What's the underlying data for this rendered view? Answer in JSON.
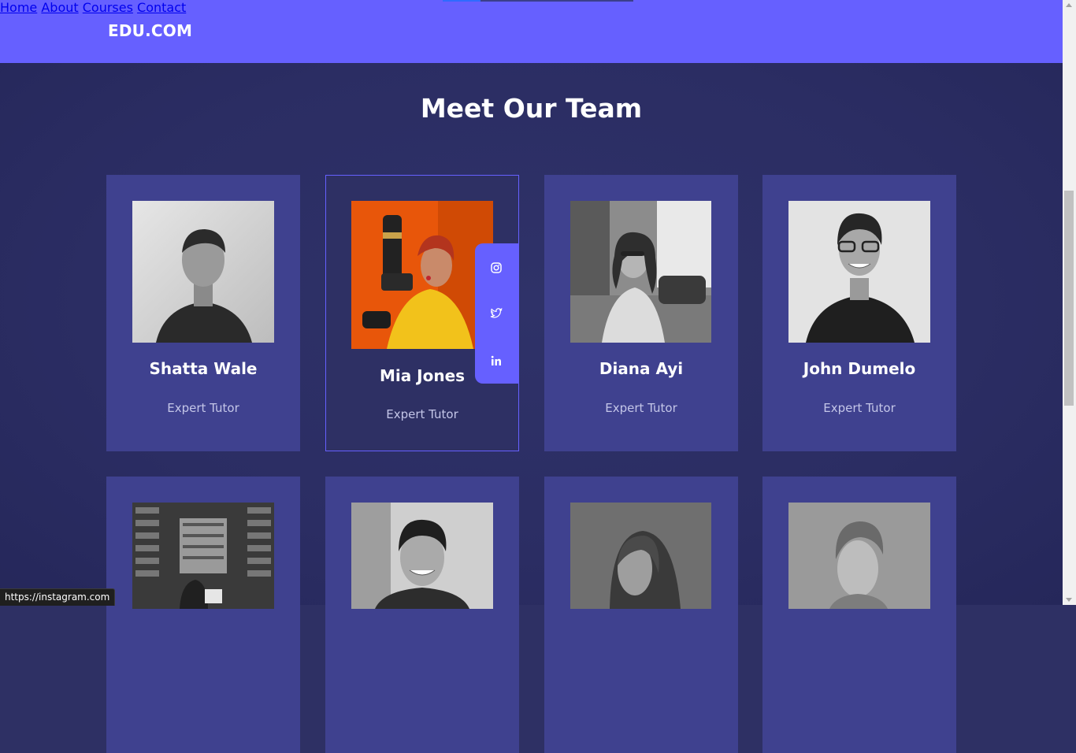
{
  "header": {
    "logo": "EDU.COM",
    "nav": [
      {
        "label": "Home"
      },
      {
        "label": "About"
      },
      {
        "label": "Courses"
      },
      {
        "label": "Contact"
      }
    ]
  },
  "section_title": "Meet Our Team",
  "team": [
    {
      "name": "Shatta Wale",
      "role": "Expert Tutor"
    },
    {
      "name": "Mia Jones",
      "role": "Expert Tutor"
    },
    {
      "name": "Diana Ayi",
      "role": "Expert Tutor"
    },
    {
      "name": "John Dumelo",
      "role": "Expert Tutor"
    }
  ],
  "social_icons": [
    "instagram-icon",
    "twitter-icon",
    "linkedin-icon"
  ],
  "status_bar_url": "https://instagram.com",
  "colors": {
    "header_bg": "#6660ff",
    "page_bg": "#2e3064",
    "card_bg": "#3f418f",
    "accent": "#6660ff"
  }
}
